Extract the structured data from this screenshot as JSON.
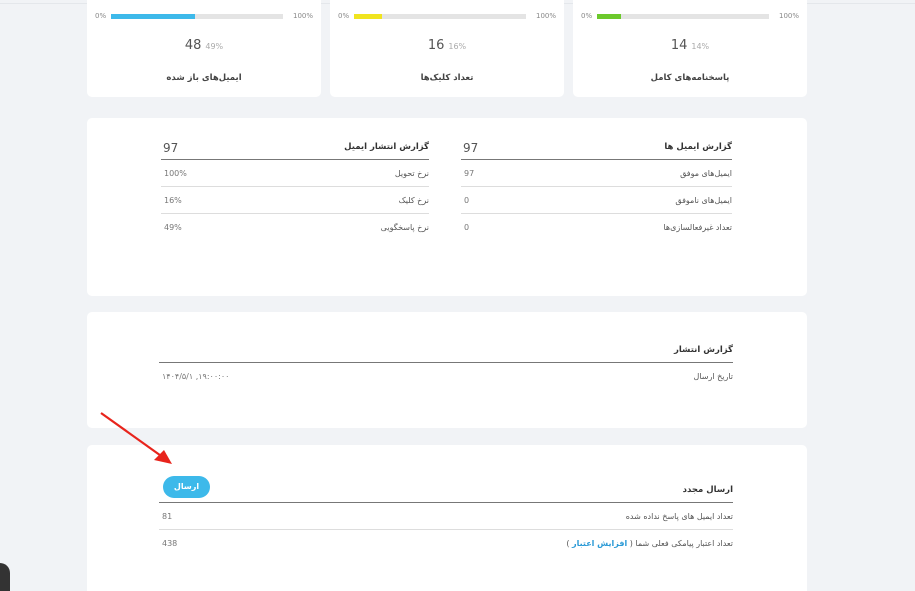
{
  "stats": [
    {
      "label": "پاسخنامه‌های کامل",
      "value": "14",
      "percent_text": "14%",
      "percent": 14,
      "min": "0%",
      "max": "100%",
      "color": "#6cc92c"
    },
    {
      "label": "تعداد کلیک‌ها",
      "value": "16",
      "percent_text": "16%",
      "percent": 16,
      "min": "0%",
      "max": "100%",
      "color": "#f0e41f"
    },
    {
      "label": "ایمیل‌های باز شده",
      "value": "48",
      "percent_text": "49%",
      "percent": 49,
      "min": "0%",
      "max": "100%",
      "color": "#3db9ea"
    }
  ],
  "email_report": {
    "title": "گزارش ایمیل ها",
    "total": "97",
    "rows": [
      {
        "label": "ایمیل‌های موفق",
        "value": "97"
      },
      {
        "label": "ایمیل‌های ناموفق",
        "value": "0"
      },
      {
        "label": "تعداد غیرفعالسازی‌ها",
        "value": "0"
      }
    ]
  },
  "publish_email_report": {
    "title": "گزارش انتشار ایمیل",
    "total": "97",
    "rows": [
      {
        "label": "نرخ تحویل",
        "value": "100%"
      },
      {
        "label": "نرخ کلیک",
        "value": "16%"
      },
      {
        "label": "نرخ پاسخگویی",
        "value": "49%"
      }
    ]
  },
  "publish_report": {
    "title": "گزارش انتشار",
    "rows": [
      {
        "label": "تاریخ ارسال",
        "value": "۱۴۰۴/۵/۱ ,۱۹:۰۰:۰۰"
      }
    ]
  },
  "resend": {
    "title": "ارسال مجدد",
    "button_label": "ارسال",
    "rows": [
      {
        "label": "تعداد ایمیل های پاسخ نداده شده",
        "value": "81"
      },
      {
        "label_prefix": "تعداد اعتبار پیامکی فعلی شما (",
        "link_text": "افزایش اعتبار",
        "label_suffix": ")",
        "value": "438"
      }
    ]
  },
  "colors": {
    "accent": "#3db9ea",
    "arrow": "#e8241c"
  }
}
